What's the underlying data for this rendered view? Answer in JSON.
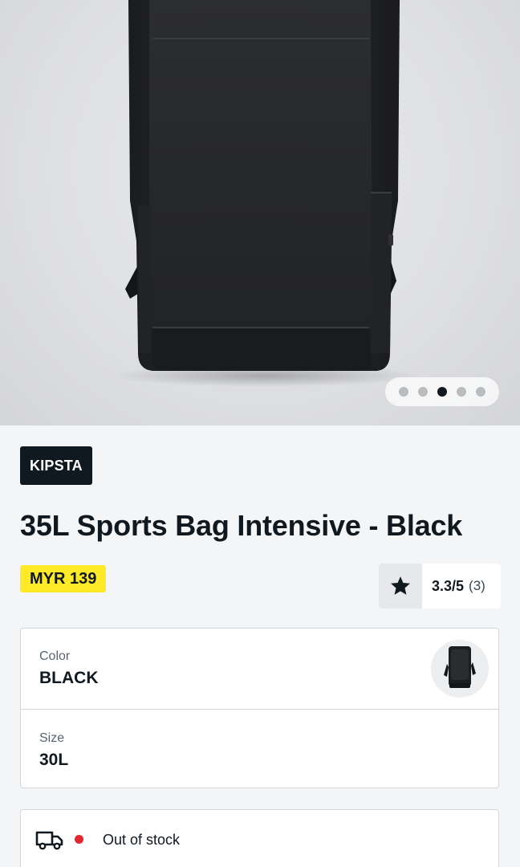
{
  "gallery": {
    "image_alt": "35L Sports Bag Intensive - Black",
    "dot_count": 5,
    "active_index": 2
  },
  "product": {
    "brand": "KIPSTA",
    "title": "35L Sports Bag Intensive - Black",
    "price": "MYR 139",
    "rating": {
      "score": "3.3/5",
      "count": "(3)"
    }
  },
  "selector": {
    "color_label": "Color",
    "color_value": "BLACK",
    "size_label": "Size",
    "size_value": "30L"
  },
  "stock": {
    "status": "Out of stock",
    "status_color": "#e3262f"
  },
  "colors": {
    "brand_bg": "#101820",
    "price_bg": "#ffea28",
    "page_bg": "#f4f5f7"
  }
}
